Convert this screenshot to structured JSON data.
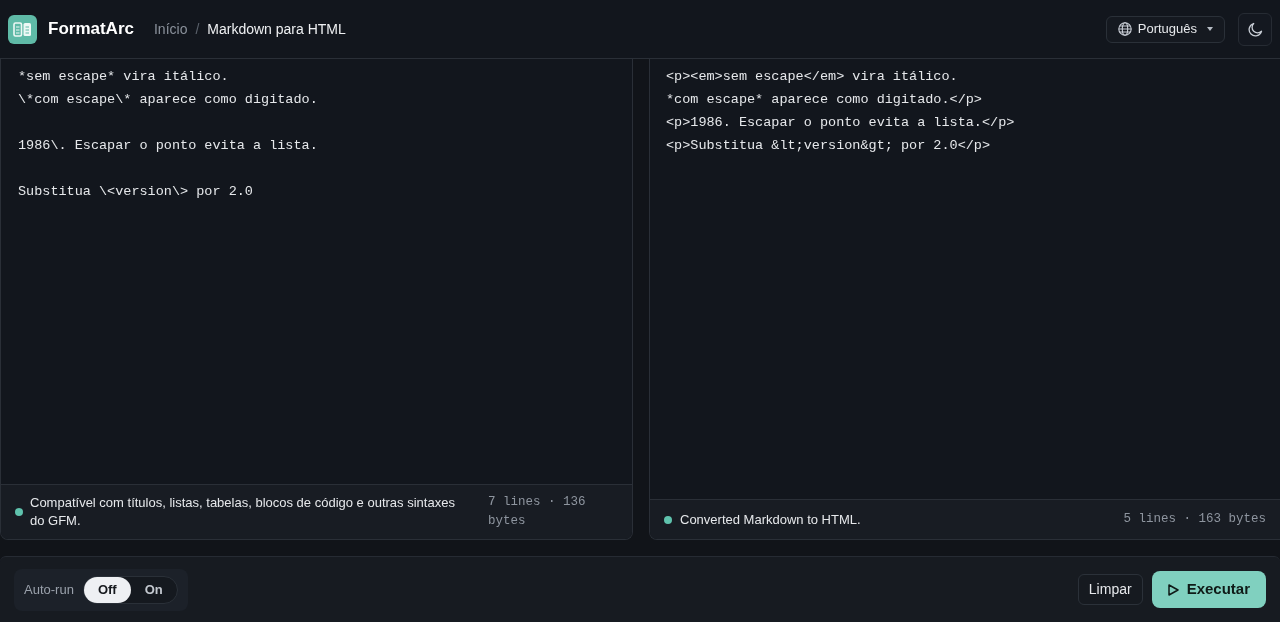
{
  "header": {
    "app_name": "FormatArc",
    "breadcrumb": [
      {
        "label": "Início",
        "current": false
      },
      {
        "label": "Markdown para HTML",
        "current": true
      }
    ],
    "separator": "/",
    "language": "Português"
  },
  "editor": {
    "paragraphs": [
      [
        "*sem escape* vira itálico.",
        "\\*com escape\\* aparece como digitado."
      ],
      [
        "1986\\. Escapar o ponto evita a lista."
      ],
      [
        "Substitua \\<version\\> por 2.0"
      ]
    ],
    "status": {
      "message": "Compatível com títulos, listas, tabelas, blocos de código e outras sintaxes do GFM.",
      "meta": "7 lines · 136 bytes"
    }
  },
  "output": {
    "lines": [
      "<p><em>sem escape</em> vira itálico.",
      "*com escape* aparece como digitado.</p>",
      "<p>1986. Escapar o ponto evita a lista.</p>",
      "<p>Substitua &lt;version&gt; por 2.0</p>"
    ],
    "status": {
      "message": "Converted Markdown to HTML.",
      "meta": "5 lines · 163 bytes"
    }
  },
  "toolbar": {
    "auto_run": {
      "label": "Auto-run",
      "options": [
        {
          "label": "Off",
          "selected": true
        },
        {
          "label": "On",
          "selected": false
        }
      ]
    },
    "buttons": [
      {
        "label": "Limpar",
        "kind": "secondary"
      },
      {
        "label": "Executar",
        "kind": "primary"
      }
    ]
  }
}
